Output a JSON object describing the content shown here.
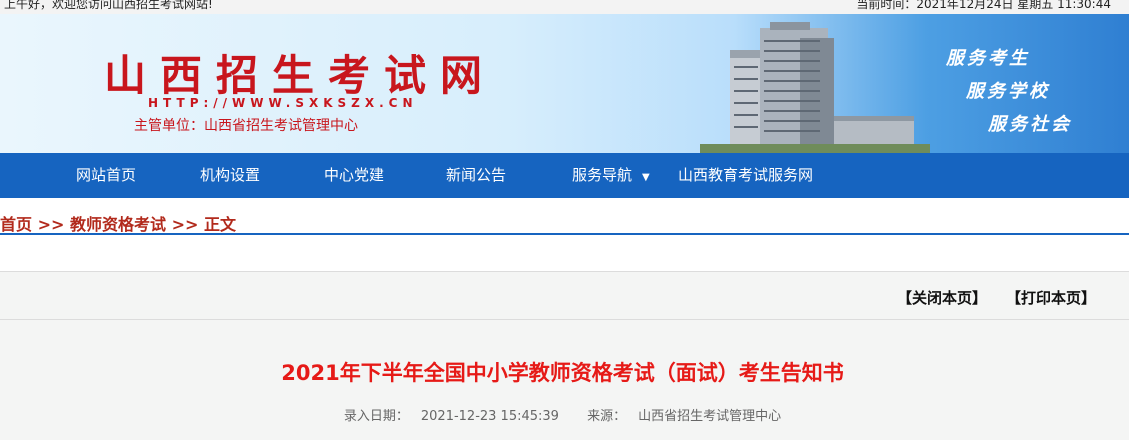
{
  "topbar": {
    "greeting": "上午好，欢迎您访问山西招生考试网站!",
    "time_label": "当前时间：",
    "time_value": "2021年12月24日 星期五 11:30:44"
  },
  "header": {
    "title": "山西招生考试网",
    "url": "HTTP://WWW.SXKSZX.CN",
    "sponsor": "主管单位：山西省招生考试管理中心",
    "slogans": [
      "服务考生",
      "服务学校",
      "服务社会"
    ]
  },
  "nav": {
    "items": [
      {
        "label": "网站首页"
      },
      {
        "label": "机构设置"
      },
      {
        "label": "中心党建"
      },
      {
        "label": "新闻公告"
      },
      {
        "label": "服务导航"
      },
      {
        "label": "山西教育考试服务网"
      }
    ]
  },
  "breadcrumb": {
    "items": [
      "首页",
      "教师资格考试",
      "正文"
    ],
    "separator": ">>"
  },
  "tools": {
    "close": "【关闭本页】",
    "print": "【打印本页】"
  },
  "article": {
    "title": "2021年下半年全国中小学教师资格考试（面试）考生告知书",
    "date_label": "录入日期：",
    "date_value": "2021-12-23 15:45:39",
    "source_label": "来源：",
    "source_value": "山西省招生考试管理中心"
  },
  "colors": {
    "nav_bg": "#1664c0",
    "title_red": "#e61a17",
    "crumb_red": "#b22a1c",
    "brand_red": "#c8161d"
  }
}
